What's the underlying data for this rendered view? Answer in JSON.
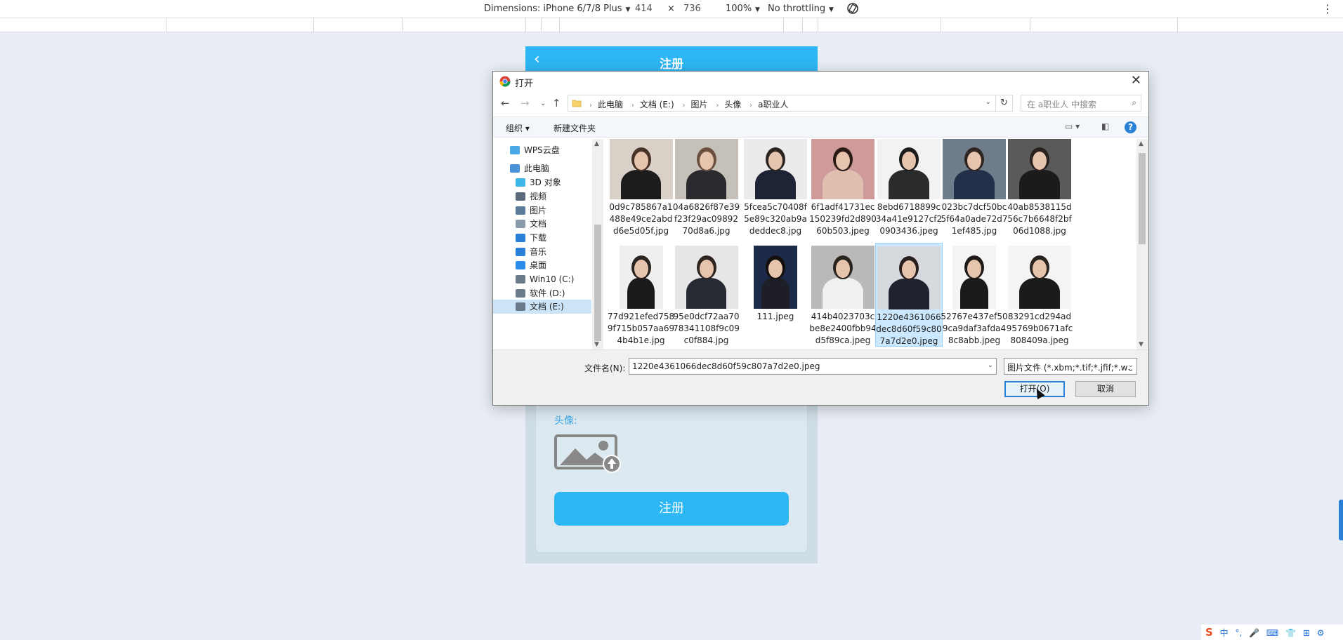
{
  "devtools": {
    "dimensions_label": "Dimensions: iPhone 6/7/8 Plus",
    "width": "414",
    "times": "×",
    "height": "736",
    "zoom": "100%",
    "throttling": "No throttling",
    "more": "⋮"
  },
  "phone": {
    "back": "‹",
    "title": "注册",
    "avatar_label": "头像:",
    "register_button": "注册"
  },
  "dialog": {
    "title": "打开",
    "close": "✕",
    "breadcrumbs": [
      "此电脑",
      "文档 (E:)",
      "图片",
      "头像",
      "a职业人"
    ],
    "search_placeholder": "在 a职业人 中搜索",
    "organize": "组织 ▾",
    "new_folder": "新建文件夹",
    "help": "?",
    "nav_items": [
      {
        "label": "WPS云盘",
        "icon": "cloud-icon",
        "color": "#4aa8e8"
      },
      {
        "label": "此电脑",
        "icon": "computer-icon",
        "color": "#4a90d9"
      },
      {
        "label": "3D 对象",
        "icon": "3d-objects-icon",
        "color": "#3fb6e8"
      },
      {
        "label": "视频",
        "icon": "video-icon",
        "color": "#5b6b7b"
      },
      {
        "label": "图片",
        "icon": "pictures-icon",
        "color": "#5b7b9b"
      },
      {
        "label": "文档",
        "icon": "documents-icon",
        "color": "#8a9aaa"
      },
      {
        "label": "下载",
        "icon": "download-icon",
        "color": "#2a7fd6"
      },
      {
        "label": "音乐",
        "icon": "music-icon",
        "color": "#2a7fd6"
      },
      {
        "label": "桌面",
        "icon": "desktop-icon",
        "color": "#2a8ee8"
      },
      {
        "label": "Win10 (C:)",
        "icon": "drive-icon",
        "color": "#6a7a8a"
      },
      {
        "label": "软件 (D:)",
        "icon": "drive-icon",
        "color": "#6a7a8a"
      },
      {
        "label": "文档 (E:)",
        "icon": "drive-icon",
        "color": "#6a7a8a"
      }
    ],
    "files": [
      {
        "name": "0d9c785867a1488e49ce2abdd6e5d05f.jpg",
        "bg": "#d9d0c8",
        "head": "#4a3328",
        "body": "#1c1c1c"
      },
      {
        "name": "04a6826f87e39f23f29ac0989270d8a6.jpg",
        "bg": "#c6c1b8",
        "head": "#6b5040",
        "body": "#2a2a2e"
      },
      {
        "name": "5fcea5c70408f5e89c320ab9adeddec8.jpg",
        "bg": "#eaeaec",
        "head": "#2e2420",
        "body": "#1e2436"
      },
      {
        "name": "6f1adf41731ec150239fd2d89060b503.jpeg",
        "bg": "#cf9a9a",
        "head": "#2a1a16",
        "body": "#e0bfb0"
      },
      {
        "name": "8ebd6718899c34a41e9127cf20903436.jpeg",
        "bg": "#f2f2f2",
        "head": "#1a1a1a",
        "body": "#2b2b2b"
      },
      {
        "name": "023bc7dcf50bc5f64a0ade72d71ef485.jpg",
        "bg": "#6f7d8a",
        "head": "#2e2520",
        "body": "#24304a"
      },
      {
        "name": "40ab8538115d56c7b6648f2bf06d1088.jpg",
        "bg": "#5a5a5a",
        "head": "#2a2020",
        "body": "#1b1b1b"
      },
      {
        "name": "77d921efed7589f715b057aa694b4b1e.jpg",
        "bg": "#efefef",
        "head": "#2a2420",
        "body": "#1a1a1a"
      },
      {
        "name": "95e0dcf72aa7078341108f9c09c0f884.jpg",
        "bg": "#e6e6e6",
        "head": "#2e2420",
        "body": "#262b33"
      },
      {
        "name": "111.jpeg",
        "bg": "#1c2a4a",
        "head": "#140f0c",
        "body": "#1e1e26"
      },
      {
        "name": "414b4023703cbe8e2400fbb94d5f89ca.jpeg",
        "bg": "#b9b9b9",
        "head": "#2a2420",
        "body": "#f0f0f0"
      },
      {
        "name": "1220e4361066dec8d60f59c807a7d2e0.jpeg",
        "bg": "#d6d9de",
        "head": "#2a2020",
        "body": "#1f2330"
      },
      {
        "name": "52767e437ef509ca9daf3afda48c8abb.jpeg",
        "bg": "#f4f4f4",
        "head": "#1f1a18",
        "body": "#1a1a1a"
      },
      {
        "name": "83291cd294ad95769b0671afc808409a.jpeg",
        "bg": "#f4f4f4",
        "head": "#2a2420",
        "body": "#1b1b1b"
      }
    ],
    "selected_index": 11,
    "filename_label": "文件名(N):",
    "filename_value": "1220e4361066dec8d60f59c807a7d2e0.jpeg",
    "filter_value": "图片文件 (*.xbm;*.tif;*.jfif;*.we",
    "open_button": "打开(O)",
    "cancel_button": "取消"
  },
  "ime": {
    "logo": "S",
    "items": [
      "中",
      "°,",
      "🎤",
      "⌨",
      "👕",
      "⊞",
      "⚙"
    ]
  },
  "colors": {
    "accent": "#2db7f5",
    "selection": "#cce8ff"
  }
}
